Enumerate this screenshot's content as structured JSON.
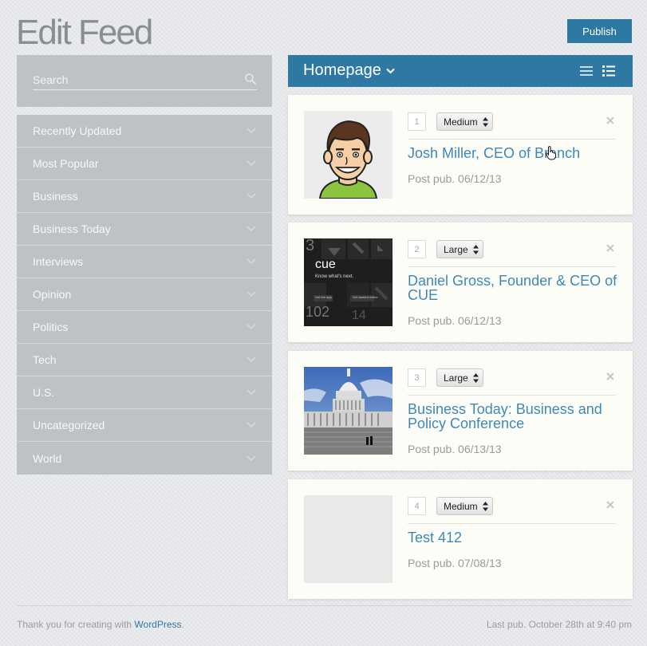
{
  "header": {
    "title": "Edit Feed",
    "publish_label": "Publish"
  },
  "sidebar": {
    "search_placeholder": "Search",
    "categories": [
      {
        "label": "Recently Updated"
      },
      {
        "label": "Most Popular"
      },
      {
        "label": "Business"
      },
      {
        "label": "Business Today"
      },
      {
        "label": "Interviews"
      },
      {
        "label": "Opinion"
      },
      {
        "label": "Politics"
      },
      {
        "label": "Tech"
      },
      {
        "label": "U.S."
      },
      {
        "label": "Uncategorized"
      },
      {
        "label": "World"
      }
    ]
  },
  "feed": {
    "name": "Homepage",
    "cards": [
      {
        "position": "1",
        "size": "Medium",
        "title": "Josh Miller, CEO of Branch",
        "meta": "Post pub. 06/12/13",
        "thumb": "avatar-illustration"
      },
      {
        "position": "2",
        "size": "Large",
        "title": "Daniel Gross, Founder & CEO of CUE",
        "meta": "Post pub. 06/12/13",
        "thumb": "cue-app-screenshot",
        "thumb_text": {
          "brand": "cue",
          "tagline": "Know what's next.",
          "btn1": "Get the app",
          "btn2": "Get started online",
          "n1": "3",
          "n2": "102",
          "n3": "14"
        }
      },
      {
        "position": "3",
        "size": "Large",
        "title": "Business Today: Business and Policy Conference",
        "meta": "Post pub. 06/13/13",
        "thumb": "capitol-building-photo"
      },
      {
        "position": "4",
        "size": "Medium",
        "title": "Test 412",
        "meta": "Post pub. 07/08/13",
        "thumb": "empty-placeholder"
      }
    ]
  },
  "footer": {
    "thanks_prefix": "Thank you for creating with ",
    "thanks_link": "WordPress",
    "thanks_suffix": ".",
    "last_pub": "Last pub. October 28th at 9:40 pm"
  },
  "colors": {
    "accent": "#2e79a4",
    "link": "#3f88b6",
    "sidebar_bg": "#bdc3c4"
  }
}
